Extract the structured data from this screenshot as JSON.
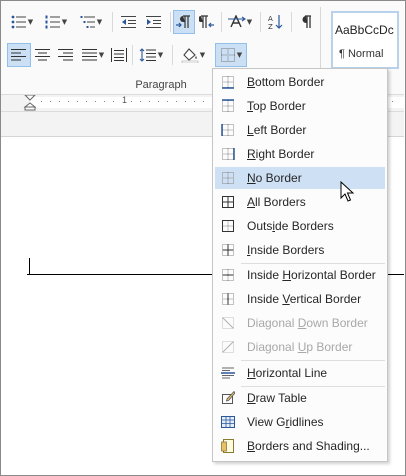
{
  "ribbon": {
    "group_label": "Paragraph",
    "style_gallery": {
      "sample": "AaBbCcDc",
      "name": "¶ Normal"
    }
  },
  "ruler": {
    "marks": [
      "1"
    ]
  },
  "borders_menu": {
    "items": [
      {
        "label": "Bottom Border",
        "icon": "bottom-border-icon",
        "state": "normal"
      },
      {
        "label": "Top Border",
        "icon": "top-border-icon",
        "state": "normal"
      },
      {
        "label": "Left Border",
        "icon": "left-border-icon",
        "state": "normal"
      },
      {
        "label": "Right Border",
        "icon": "right-border-icon",
        "state": "normal"
      },
      {
        "label": "No Border",
        "icon": "no-border-icon",
        "state": "highlighted"
      },
      {
        "label": "All Borders",
        "icon": "all-borders-icon",
        "state": "normal"
      },
      {
        "label": "Outside Borders",
        "icon": "outside-borders-icon",
        "state": "normal"
      },
      {
        "label": "Inside Borders",
        "icon": "inside-borders-icon",
        "state": "normal"
      },
      {
        "label": "Inside Horizontal Border",
        "icon": "inside-horizontal-border-icon",
        "state": "normal"
      },
      {
        "label": "Inside Vertical Border",
        "icon": "inside-vertical-border-icon",
        "state": "normal"
      },
      {
        "label": "Diagonal Down Border",
        "icon": "diagonal-down-border-icon",
        "state": "disabled"
      },
      {
        "label": "Diagonal Up Border",
        "icon": "diagonal-up-border-icon",
        "state": "disabled"
      },
      {
        "label": "Horizontal Line",
        "icon": "horizontal-line-icon",
        "state": "normal"
      },
      {
        "label": "Draw Table",
        "icon": "draw-table-icon",
        "state": "normal"
      },
      {
        "label": "View Gridlines",
        "icon": "view-gridlines-icon",
        "state": "normal"
      },
      {
        "label": "Borders and Shading...",
        "icon": "borders-and-shading-icon",
        "state": "normal"
      }
    ]
  },
  "colors": {
    "accent": "#2b579a",
    "highlight": "#cee0f4",
    "active_button": "#cce0f5",
    "disabled_text": "#a8a8a8"
  }
}
